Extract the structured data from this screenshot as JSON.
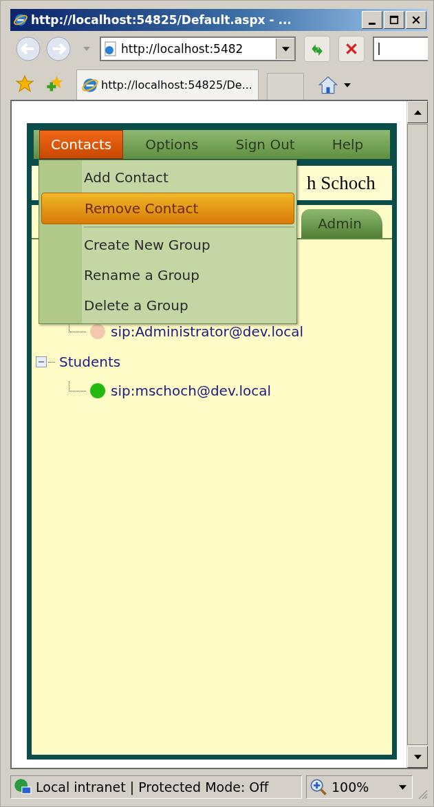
{
  "window": {
    "title": "http://localhost:54825/Default.aspx - ..."
  },
  "address_bar": {
    "value": "http://localhost:5482"
  },
  "search_field": {
    "value": "|"
  },
  "browser_tabs": [
    {
      "label": "http://localhost:54825/De...",
      "selected": true
    }
  ],
  "app": {
    "menu_bar": [
      {
        "label": "Contacts",
        "selected": true
      },
      {
        "label": "Options",
        "selected": false
      },
      {
        "label": "Sign Out",
        "selected": false
      },
      {
        "label": "Help",
        "selected": false
      }
    ],
    "dropdown": [
      {
        "kind": "item",
        "label": "Add Contact",
        "selected": false
      },
      {
        "kind": "item",
        "label": "Remove Contact",
        "selected": true
      },
      {
        "kind": "separator"
      },
      {
        "kind": "item",
        "label": "Create New Group",
        "selected": false
      },
      {
        "kind": "item",
        "label": "Rename a Group",
        "selected": false
      },
      {
        "kind": "item",
        "label": "Delete a Group",
        "selected": false
      }
    ],
    "user_name": "h Schoch",
    "tabs": [
      {
        "label": "Admin",
        "selected": false
      }
    ],
    "tree": [
      {
        "children": [
          {
            "label": "sip:Administrator@dev.local",
            "color": "#f3c9b0"
          }
        ]
      },
      {
        "label": "Students",
        "expanded": true,
        "children": [
          {
            "label": "sip:mschoch@dev.local",
            "color": "#22b80e"
          }
        ]
      }
    ]
  },
  "status_bar": {
    "zone": "Local intranet | Protected Mode: Off",
    "zoom": "100%"
  }
}
